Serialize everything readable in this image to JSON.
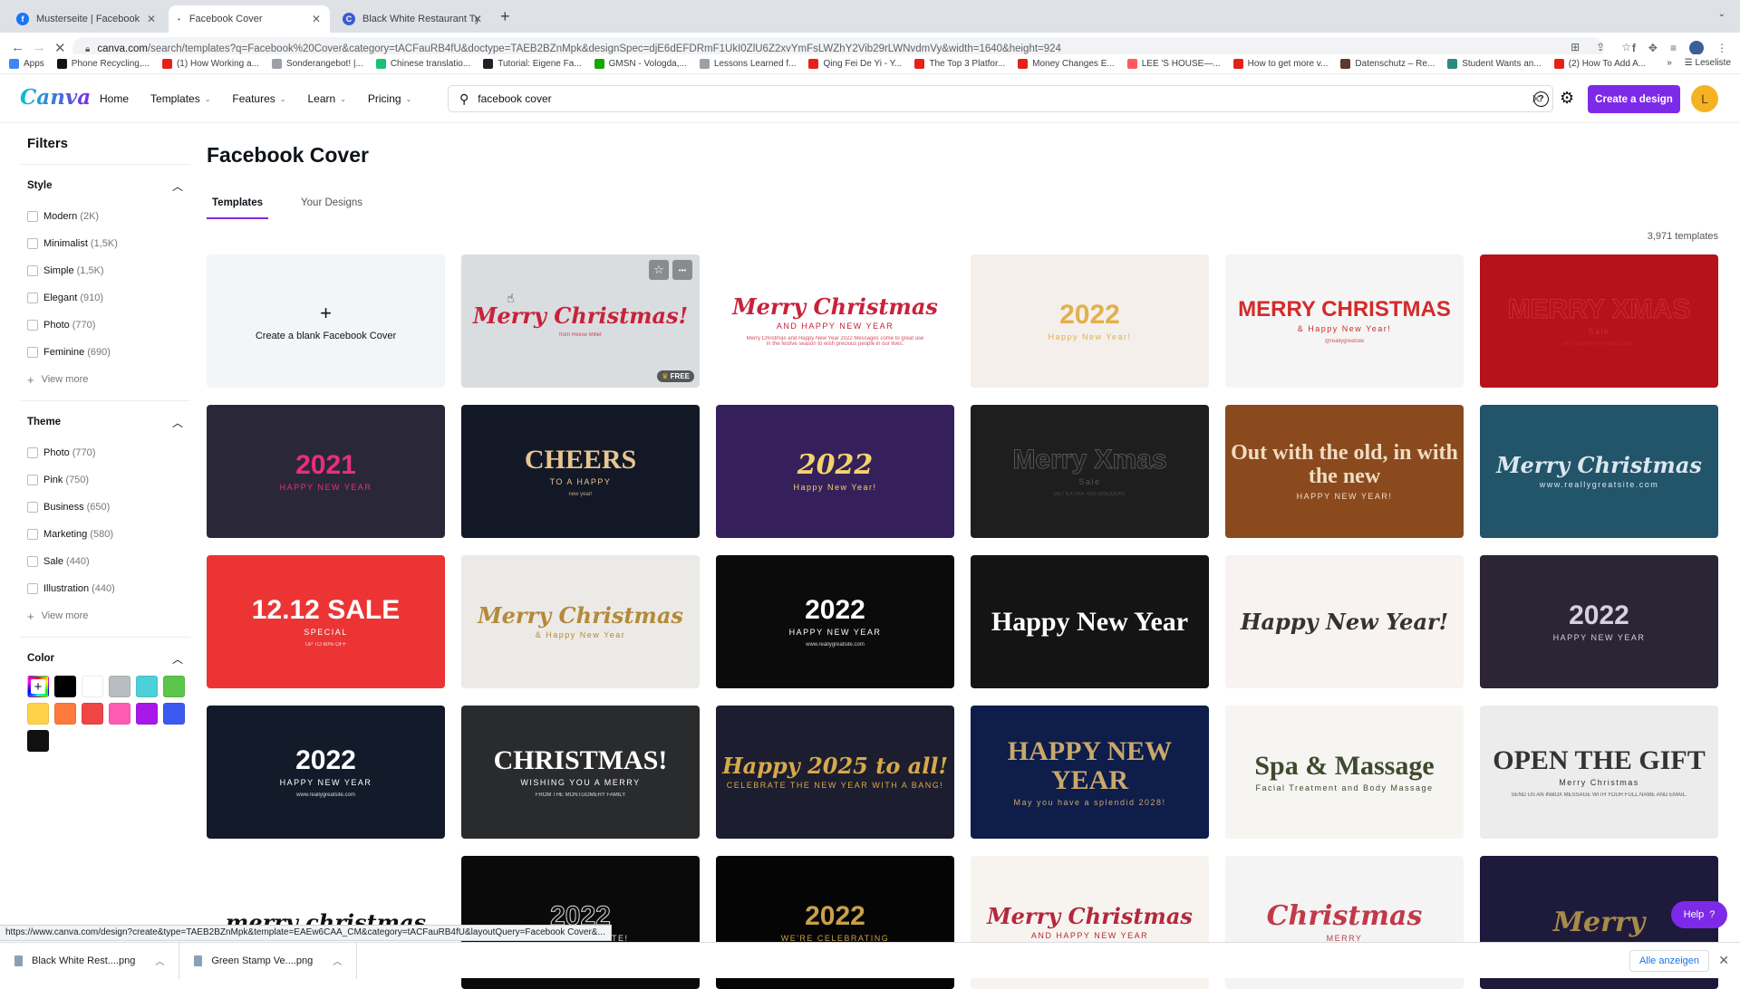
{
  "browser": {
    "tabs": [
      {
        "title": "Musterseite | Facebook",
        "icon": "facebook-icon",
        "active": false
      },
      {
        "title": "Facebook Cover",
        "icon": "loading-dot-icon",
        "active": true
      },
      {
        "title": "Black White Restaurant Typog",
        "icon": "canva-icon",
        "active": false
      }
    ],
    "new_tab_label": "+",
    "url_host": "canva.com",
    "url_path": "/search/templates?q=Facebook%20Cover&category=tACFauRB4fU&doctype=TAEB2BZnMpk&designSpec=djE6dEFDRmF1UkI0ZlU6Z2xvYmFsLWZhY2Vib29rLWNvdmVy&width=1640&height=924",
    "bookmarks": [
      {
        "label": "Apps",
        "icon": "apps-grid-icon",
        "color": "#4285f4"
      },
      {
        "label": "Phone Recycling,...",
        "icon": "o2-icon",
        "color": "#0e1318"
      },
      {
        "label": "(1) How Working a...",
        "icon": "youtube-icon",
        "color": "#e62117"
      },
      {
        "label": "Sonderangebot! |...",
        "icon": "check-circle-icon",
        "color": "#9aa0a6"
      },
      {
        "label": "Chinese translatio...",
        "icon": "fiverr-icon",
        "color": "#1dbf73"
      },
      {
        "label": "Tutorial: Eigene Fa...",
        "icon": "hash-icon",
        "color": "#202124"
      },
      {
        "label": "GMSN - Vologda,...",
        "icon": "upwork-icon",
        "color": "#14a800"
      },
      {
        "label": "Lessons Learned f...",
        "icon": "percent-icon",
        "color": "#9aa0a6"
      },
      {
        "label": "Qing Fei De Yi - Y...",
        "icon": "youtube-icon",
        "color": "#e62117"
      },
      {
        "label": "The Top 3 Platfor...",
        "icon": "youtube-icon",
        "color": "#e62117"
      },
      {
        "label": "Money Changes E...",
        "icon": "youtube-icon",
        "color": "#e62117"
      },
      {
        "label": "LEE 'S HOUSE—...",
        "icon": "airbnb-icon",
        "color": "#ff5a5f"
      },
      {
        "label": "How to get more v...",
        "icon": "youtube-icon",
        "color": "#e62117"
      },
      {
        "label": "Datenschutz – Re...",
        "icon": "site-image-icon",
        "color": "#5b3a2e"
      },
      {
        "label": "Student Wants an...",
        "icon": "t-circle-icon",
        "color": "#2a8c7e"
      },
      {
        "label": "(2) How To Add A...",
        "icon": "youtube-icon",
        "color": "#e62117"
      }
    ],
    "bookmarks_overflow": "»",
    "reading_list": "Leseliste"
  },
  "header": {
    "logo": "Canva",
    "nav": [
      {
        "label": "Home",
        "dropdown": false
      },
      {
        "label": "Templates",
        "dropdown": true
      },
      {
        "label": "Features",
        "dropdown": true
      },
      {
        "label": "Learn",
        "dropdown": true
      },
      {
        "label": "Pricing",
        "dropdown": true
      }
    ],
    "search_value": "facebook cover",
    "help_icon": "?",
    "create_label": "Create a design",
    "avatar_initial": "L",
    "accent": "#7d2ae8"
  },
  "filters": {
    "title": "Filters",
    "style": {
      "label": "Style",
      "options": [
        {
          "name": "Modern",
          "count": "(2K)"
        },
        {
          "name": "Minimalist",
          "count": "(1,5K)"
        },
        {
          "name": "Simple",
          "count": "(1,5K)"
        },
        {
          "name": "Elegant",
          "count": "(910)"
        },
        {
          "name": "Photo",
          "count": "(770)"
        },
        {
          "name": "Feminine",
          "count": "(690)"
        }
      ],
      "view_more": "View more"
    },
    "theme": {
      "label": "Theme",
      "options": [
        {
          "name": "Photo",
          "count": "(770)"
        },
        {
          "name": "Pink",
          "count": "(750)"
        },
        {
          "name": "Business",
          "count": "(650)"
        },
        {
          "name": "Marketing",
          "count": "(580)"
        },
        {
          "name": "Sale",
          "count": "(440)"
        },
        {
          "name": "Illustration",
          "count": "(440)"
        }
      ],
      "view_more": "View more"
    },
    "color": {
      "label": "Color",
      "custom_label": "+",
      "swatches": [
        "#000000",
        "#ffffff",
        "#b9bcc0",
        "#4dd0d8",
        "#5cc54a",
        "#ffd24a",
        "#ff7a3d",
        "#f04545",
        "#ff5bb5",
        "#a818e8",
        "#3b5bf0",
        "#111111"
      ]
    }
  },
  "main": {
    "title": "Facebook Cover",
    "tabs": [
      {
        "label": "Templates",
        "active": true
      },
      {
        "label": "Your Designs",
        "active": false
      }
    ],
    "template_count": "3,971 templates",
    "blank_card": {
      "plus": "+",
      "label": "Create a blank Facebook Cover"
    },
    "hover_card": {
      "free_badge": "FREE",
      "star": "☆",
      "more": "•••"
    },
    "templates": [
      {
        "t1": "Merry Christmas!",
        "t2": "",
        "t3": "from Reese Miller",
        "bg": "#d9dde0",
        "fg": "#c8223a",
        "style": "script"
      },
      {
        "t1": "Merry Christmas",
        "t2": "AND HAPPY NEW YEAR",
        "t3": "Merry Christmas and Happy New Year 2022 Messages come to great use in the festive season to wish precious people in our lives.",
        "bg": "#ffffff",
        "fg": "#c8223a",
        "style": "script"
      },
      {
        "t1": "2022",
        "t2": "Happy New Year!",
        "t3": "",
        "bg": "#f4efea",
        "fg": "#e2b04c",
        "style": "bold"
      },
      {
        "t1": "MERRY CHRISTMAS",
        "t2": "& Happy New Year!",
        "t3": "@reallygreatsite",
        "bg": "#f5f5f5",
        "fg": "#d42a2a",
        "style": "bold"
      },
      {
        "t1": "MERRY XMAS",
        "t2": "Sale",
        "t3": "GET EXTRA 70% DISCOUNT",
        "bg": "#b5121b",
        "fg": "#cf2a33",
        "style": "outline"
      },
      {
        "t1": "2021",
        "t2": "HAPPY NEW YEAR",
        "t3": "",
        "bg": "#2a2838",
        "fg": "#ea2d7d",
        "style": "bold"
      },
      {
        "t1": "CHEERS",
        "t2": "TO A HAPPY",
        "t3": "new year!",
        "bg": "#121826",
        "fg": "#e8c58e",
        "style": "serif"
      },
      {
        "t1": "2022",
        "t2": "Happy New Year!",
        "t3": "",
        "bg": "#35205c",
        "fg": "#f2d46a",
        "style": "script"
      },
      {
        "t1": "Merry Xmas",
        "t2": "Sale",
        "t3": "GET EXTRA 70% DISCOUNT",
        "bg": "#1e1e1e",
        "fg": "#555555",
        "style": "outline"
      },
      {
        "t1": "Out with the old, in with the new",
        "t2": "HAPPY NEW YEAR!",
        "t3": "",
        "bg": "#8a4a1e",
        "fg": "#f1dcc4",
        "style": "serif"
      },
      {
        "t1": "Merry Christmas",
        "t2": "www.reallygreatsite.com",
        "t3": "",
        "bg": "#22546a",
        "fg": "#dbe7ee",
        "style": "script"
      },
      {
        "t1": "12.12 SALE",
        "t2": "SPECIAL",
        "t3": "UP TO 60% OFF",
        "bg": "#ec3434",
        "fg": "#ffffff",
        "style": "bold"
      },
      {
        "t1": "Merry Christmas",
        "t2": "& Happy New Year",
        "t3": "",
        "bg": "#eceae7",
        "fg": "#b38a3a",
        "style": "script"
      },
      {
        "t1": "2022",
        "t2": "HAPPY NEW YEAR",
        "t3": "www.reallygreatsite.com",
        "bg": "#0b0b0b",
        "fg": "#ffffff",
        "style": "bold"
      },
      {
        "t1": "Happy New Year",
        "t2": "",
        "t3": "",
        "bg": "#141414",
        "fg": "#ffffff",
        "style": "serif"
      },
      {
        "t1": "Happy New Year!",
        "t2": "",
        "t3": "",
        "bg": "#f8f2f0",
        "fg": "#333333",
        "style": "script"
      },
      {
        "t1": "2022",
        "t2": "HAPPY NEW YEAR",
        "t3": "",
        "bg": "#2b2535",
        "fg": "#d7d1dd",
        "style": "bold"
      },
      {
        "t1": "2022",
        "t2": "HAPPY NEW YEAR",
        "t3": "www.reallygreatsite.com",
        "bg": "#131b2a",
        "fg": "#ffffff",
        "style": "bold"
      },
      {
        "t1": "CHRISTMAS!",
        "t2": "WISHING YOU A MERRY",
        "t3": "FROM THE MONTGOMERY FAMILY",
        "bg": "#2a2b2d",
        "fg": "#ffffff",
        "style": "serif"
      },
      {
        "t1": "Happy 2025 to all!",
        "t2": "CELEBRATE THE NEW YEAR WITH A BANG!",
        "t3": "",
        "bg": "#1c1d2e",
        "fg": "#d6a94a",
        "style": "script"
      },
      {
        "t1": "HAPPY NEW YEAR",
        "t2": "May you have a splendid 2028!",
        "t3": "",
        "bg": "#0e1d4a",
        "fg": "#c9a86a",
        "style": "serif"
      },
      {
        "t1": "Spa & Massage",
        "t2": "Facial Treatment and Body Massage",
        "t3": "",
        "bg": "#f7f5f2",
        "fg": "#3d4a2e",
        "style": "serif"
      },
      {
        "t1": "OPEN THE GIFT",
        "t2": "Merry Christmas",
        "t3": "SEND US AN INBOX MESSAGE WITH YOUR FULL NAME AND EMAIL.",
        "bg": "#ececec",
        "fg": "#333333",
        "style": "serif"
      },
      {
        "t1": "merry christmas",
        "t2": "",
        "t3": "",
        "bg": "#ffffff",
        "fg": "#111111",
        "style": "script"
      },
      {
        "t1": "2022",
        "t2": "LET'S CELEBRATE!",
        "t3": "",
        "bg": "#0a0a0a",
        "fg": "#dddddd",
        "style": "outline"
      },
      {
        "t1": "2022",
        "t2": "WE'RE CELEBRATING",
        "t3": "",
        "bg": "#050505",
        "fg": "#c9a04a",
        "style": "bold"
      },
      {
        "t1": "Merry Christmas",
        "t2": "AND HAPPY NEW YEAR",
        "t3": "",
        "bg": "#f7f4f0",
        "fg": "#b4283c",
        "style": "script"
      },
      {
        "t1": "Christmas",
        "t2": "MERRY",
        "t3": "",
        "bg": "#f4f4f4",
        "fg": "#c03a4a",
        "style": "script"
      },
      {
        "t1": "Merry",
        "t2": "",
        "t3": "",
        "bg": "#1d1a3c",
        "fg": "#a88a4a",
        "style": "script"
      }
    ]
  },
  "status_url": "https://www.canva.com/design?create&type=TAEB2BZnMpk&template=EAEw6CAA_CM&category=tACFauRB4fU&layoutQuery=Facebook Cover&...",
  "help_button": {
    "label": "Help",
    "icon": "?"
  },
  "downloads": {
    "items": [
      {
        "name": "Black White Rest....png"
      },
      {
        "name": "Green Stamp Ve....png"
      }
    ],
    "show_all": "Alle anzeigen",
    "close": "✕"
  }
}
